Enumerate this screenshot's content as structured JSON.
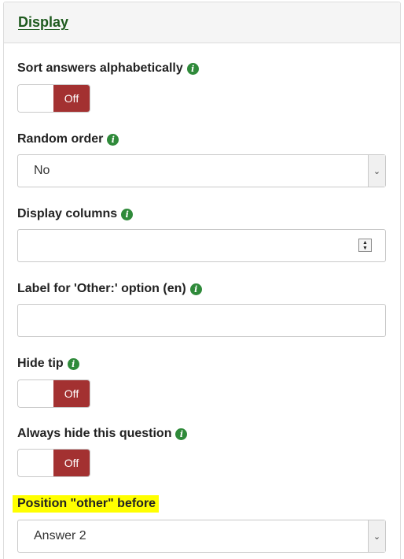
{
  "panel": {
    "title": "Display"
  },
  "fields": {
    "sort_answers": {
      "label": "Sort answers alphabetically",
      "state": "Off"
    },
    "random_order": {
      "label": "Random order",
      "value": "No"
    },
    "display_columns": {
      "label": "Display columns",
      "value": ""
    },
    "other_label": {
      "label": "Label for 'Other:' option (en)",
      "value": ""
    },
    "hide_tip": {
      "label": "Hide tip",
      "state": "Off"
    },
    "always_hide": {
      "label": "Always hide this question",
      "state": "Off"
    },
    "position_other": {
      "label": "Position \"other\" before",
      "value": "Answer 2"
    }
  },
  "icons": {
    "info": "info-icon",
    "dropdown": "chevron-down-icon",
    "spinner": "number-spinner-icon"
  },
  "colors": {
    "off_toggle": "#a33131",
    "info_icon": "#2f8a3a",
    "highlight": "#ffff00",
    "title": "#1e5a1e"
  }
}
